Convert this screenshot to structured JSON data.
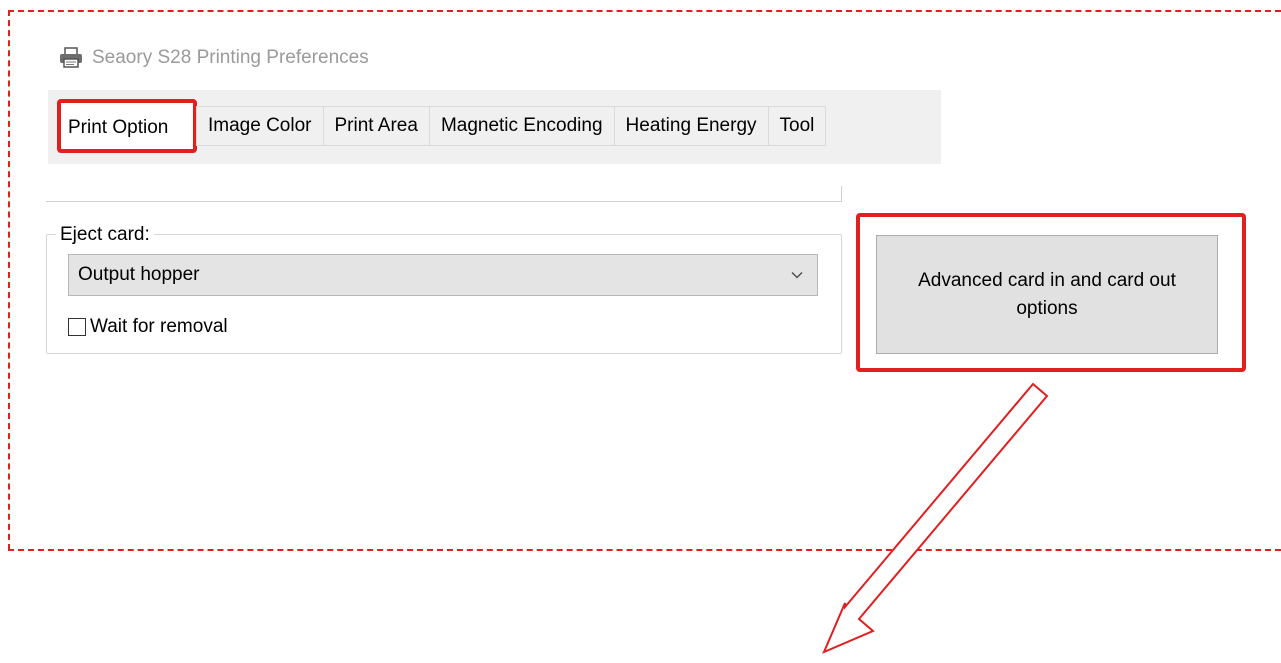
{
  "window": {
    "title": "Seaory S28 Printing Preferences",
    "icon": "printer-icon"
  },
  "tabs": {
    "active": "Print Option",
    "items": [
      {
        "label": "Image Color"
      },
      {
        "label": "Print Area"
      },
      {
        "label": "Magnetic Encoding"
      },
      {
        "label": "Heating Energy"
      },
      {
        "label": "Tool"
      }
    ]
  },
  "eject": {
    "group_label": "Eject card:",
    "selected_option": "Output hopper",
    "wait_label": "Wait for removal",
    "wait_checked": false
  },
  "advanced_button": {
    "label": "Advanced card in and card out options"
  },
  "annotations": {
    "highlight_color": "#e21f1f"
  }
}
